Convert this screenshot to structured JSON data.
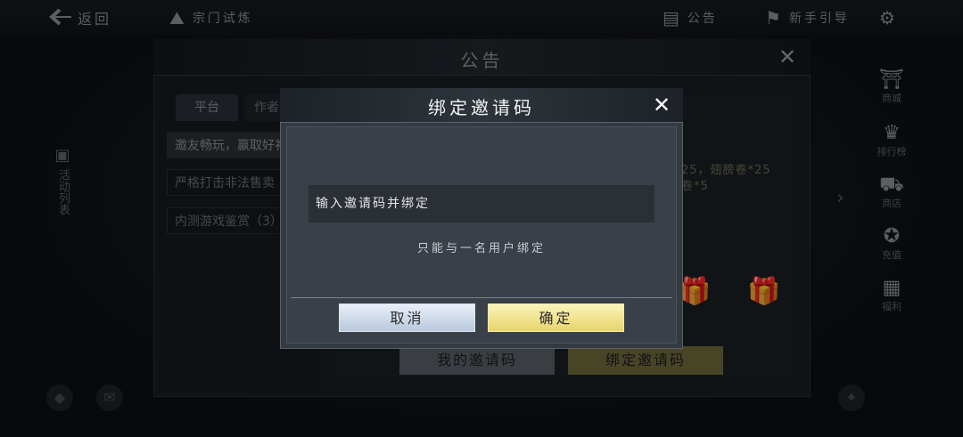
{
  "topbar": {
    "back_label": "返回",
    "sect_label": "宗门试炼",
    "notice_label": "公告",
    "guide_label": "新手引导"
  },
  "left_side": {
    "vertical_label": "活动列表"
  },
  "right_side": [
    "商城",
    "排行榜",
    "商店",
    "充值",
    "福利"
  ],
  "announcement": {
    "title": "公告",
    "tabs": [
      "平台",
      "作者"
    ],
    "items": [
      "邀友畅玩，赢取好礼",
      "严格打击非法售卖",
      "内测游戏鉴赏（3）"
    ],
    "reward_text_1": "25，翅膀卷*25",
    "reward_text_2": "卷*5",
    "my_code_button": "我的邀请码",
    "bind_code_button": "绑定邀请码"
  },
  "modal": {
    "title": "绑定邀请码",
    "input_placeholder": "输入邀请码并绑定",
    "hint": "只能与一名用户绑定",
    "cancel_label": "取消",
    "confirm_label": "确定"
  },
  "icons": {
    "back": "arrow-left-icon",
    "sect": "sect-icon",
    "notice": "notice-icon",
    "guide": "guide-icon",
    "settings": "gear-icon",
    "close": "close-icon",
    "gift": "gift-box-icon"
  },
  "colors": {
    "confirm_button": "#e8d56c",
    "cancel_button": "#c9d6e6",
    "modal_bg": "#343a42"
  }
}
